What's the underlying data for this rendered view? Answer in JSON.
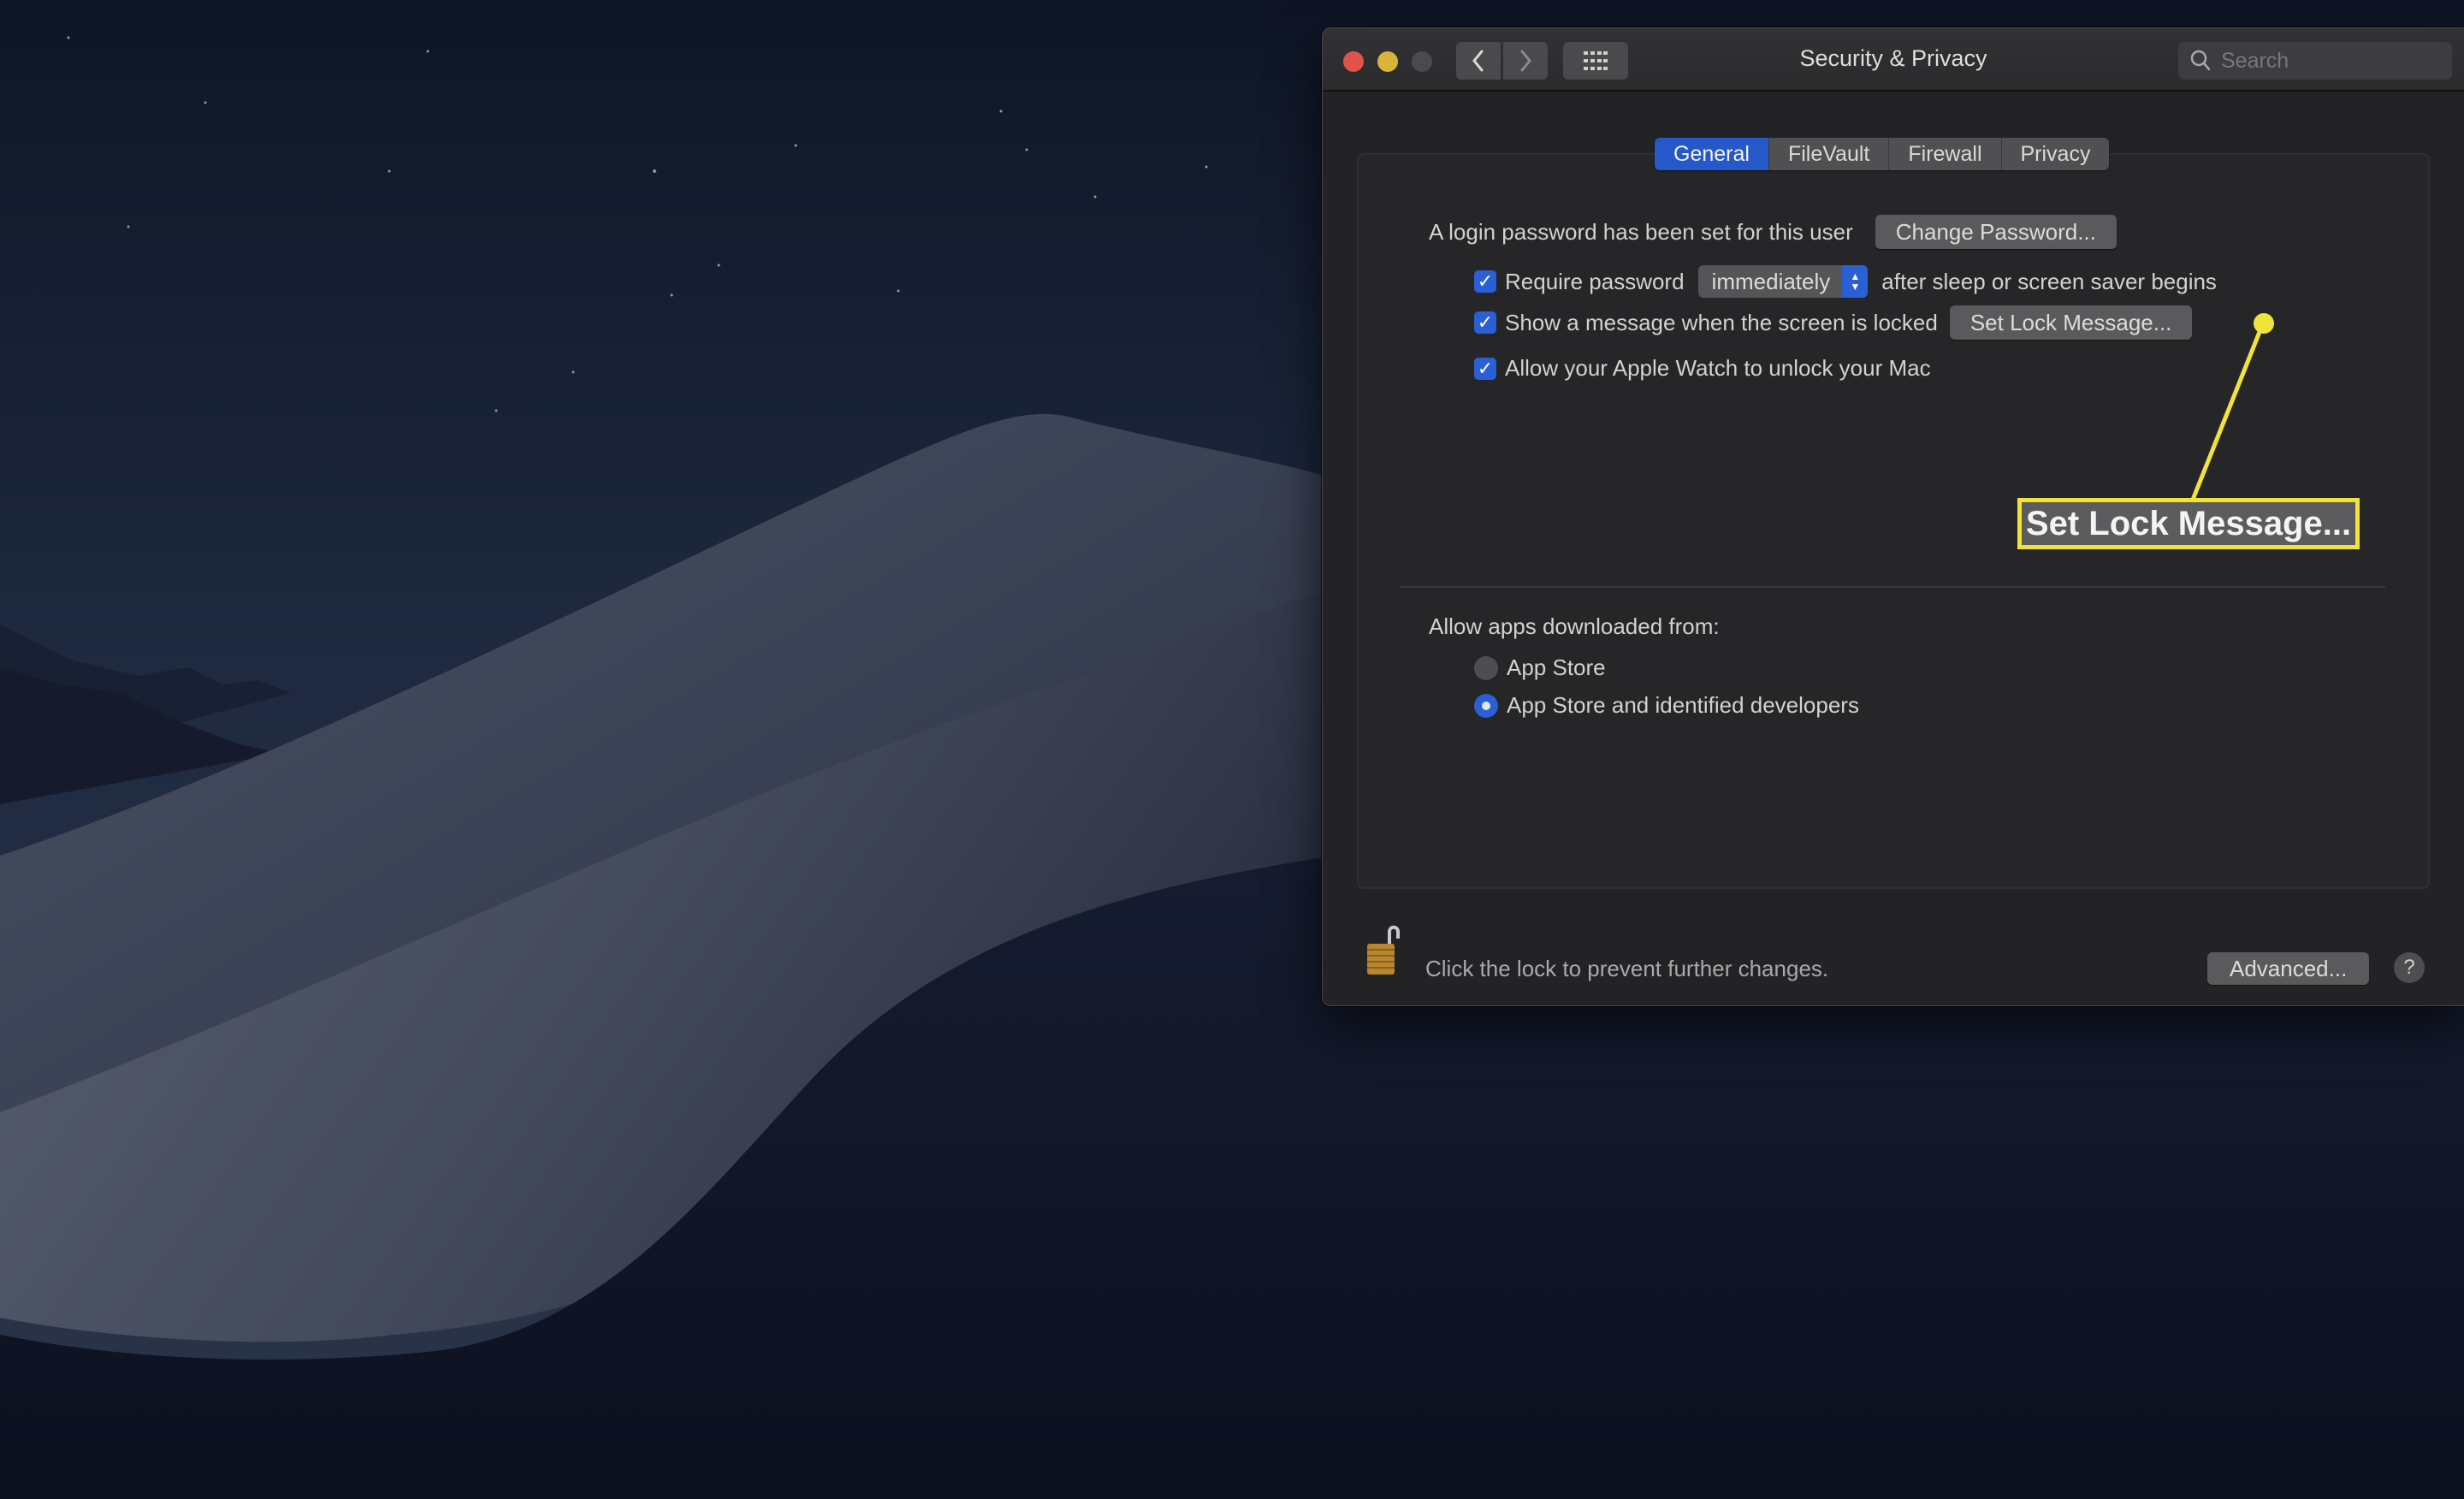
{
  "window": {
    "title": "Security & Privacy",
    "search_placeholder": "Search"
  },
  "tabs": [
    {
      "label": "General",
      "active": true
    },
    {
      "label": "FileVault",
      "active": false
    },
    {
      "label": "Firewall",
      "active": false
    },
    {
      "label": "Privacy",
      "active": false
    }
  ],
  "general": {
    "login_password_text": "A login password has been set for this user",
    "change_password_button": "Change Password...",
    "require_password": {
      "label": "Require password",
      "checked": true,
      "selected_option": "immediately",
      "suffix": "after sleep or screen saver begins"
    },
    "show_message": {
      "label": "Show a message when the screen is locked",
      "checked": true,
      "button": "Set Lock Message..."
    },
    "apple_watch": {
      "label": "Allow your Apple Watch to unlock your Mac",
      "checked": true
    },
    "allow_apps_label": "Allow apps downloaded from:",
    "allow_apps_options": [
      {
        "label": "App Store",
        "selected": false
      },
      {
        "label": "App Store and identified developers",
        "selected": true
      }
    ]
  },
  "footer": {
    "lock_text": "Click the lock to prevent further changes.",
    "advanced_button": "Advanced...",
    "help_label": "?"
  },
  "annotation": {
    "callout_text": "Set Lock Message...",
    "color": "#f2e33a"
  },
  "icons": {
    "back": "chevron-left",
    "forward": "chevron-right",
    "grid": "show-all-grid",
    "search": "magnifying-glass",
    "lock": "padlock-open",
    "check": "✓"
  },
  "colors": {
    "accent": "#2a5fd6",
    "tab_active": "#2558c9",
    "window_bg": "#232325",
    "close": "#e0524a",
    "minimize": "#d9b33a",
    "zoom_disabled": "#4b4b4d"
  }
}
